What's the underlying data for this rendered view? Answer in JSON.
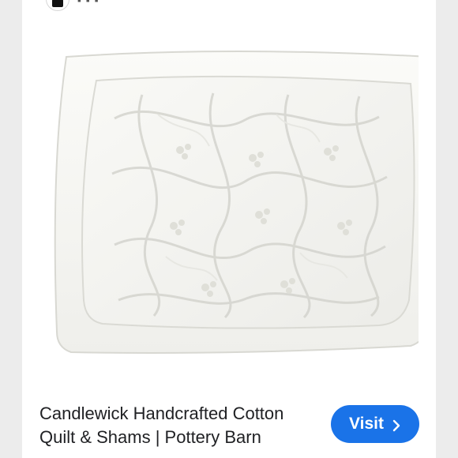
{
  "header": {
    "app_icon": "google-lens-icon"
  },
  "product": {
    "image_icon": "pillow-sham-image",
    "title_line1": "Candlewick Handcrafted Cotton",
    "title_line2": "Quilt & Shams | Pottery Barn"
  },
  "actions": {
    "visit_label": "Visit",
    "visit_icon": "chevron-right-icon",
    "accent_color": "#1a73e8"
  }
}
